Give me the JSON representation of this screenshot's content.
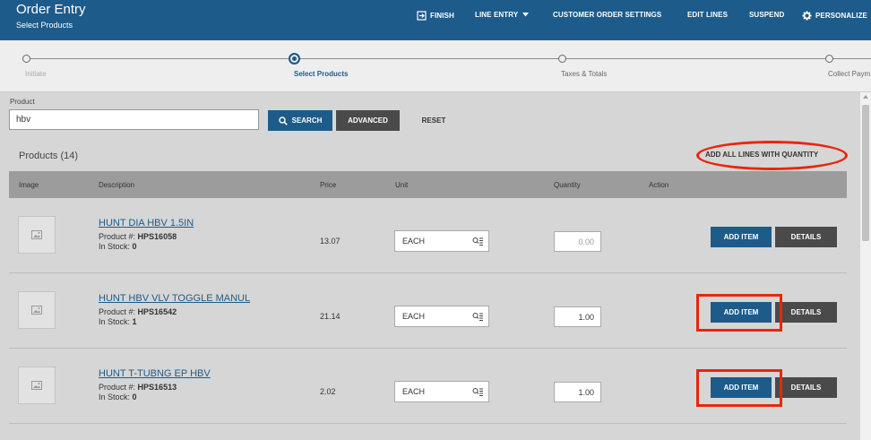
{
  "header": {
    "title": "Order Entry",
    "subtitle": "Select Products",
    "nav": {
      "finish": "FINISH",
      "line_entry": "LINE ENTRY",
      "customer_order_settings": "CUSTOMER ORDER SETTINGS",
      "edit_lines": "EDIT LINES",
      "suspend": "SUSPEND",
      "personalize": "PERSONALIZE"
    },
    "icons": {
      "finish": "exit-icon",
      "line_entry": "chevron-down-icon",
      "personalize": "gear-icon"
    }
  },
  "stepper": {
    "steps": [
      {
        "label": "Initiate",
        "state": "done"
      },
      {
        "label": "Select Products",
        "state": "active"
      },
      {
        "label": "Taxes & Totals",
        "state": "pending"
      },
      {
        "label": "Collect Paym",
        "state": "pending"
      }
    ]
  },
  "search": {
    "label": "Product",
    "value": "hbv",
    "search_button": "SEARCH",
    "advanced_button": "ADVANCED",
    "reset_button": "RESET"
  },
  "products": {
    "title": "Products (14)",
    "add_all_button": "ADD ALL LINES WITH QUANTITY",
    "columns": [
      "Image",
      "Description",
      "Price",
      "Unit",
      "Quantity",
      "Action"
    ],
    "product_number_label": "Product #:",
    "in_stock_label": "In Stock:",
    "add_item_label": "ADD ITEM",
    "details_label": "DETAILS",
    "rows": [
      {
        "name": "HUNT DIA HBV 1.5IN",
        "product_number": "HPS16058",
        "in_stock": "0",
        "price": "13.07",
        "unit": "EACH",
        "quantity": "0.00"
      },
      {
        "name": "HUNT HBV VLV TOGGLE MANUL",
        "product_number": "HPS16542",
        "in_stock": "1",
        "price": "21.14",
        "unit": "EACH",
        "quantity": "1.00"
      },
      {
        "name": "HUNT T-TUBNG EP HBV",
        "product_number": "HPS16513",
        "in_stock": "0",
        "price": "2.02",
        "unit": "EACH",
        "quantity": "1.00"
      }
    ]
  },
  "colors": {
    "header_bg": "#1d5b8a",
    "primary_button": "#1d5b8a",
    "secondary_button": "#4a4a4a",
    "highlight": "#e8260d"
  }
}
